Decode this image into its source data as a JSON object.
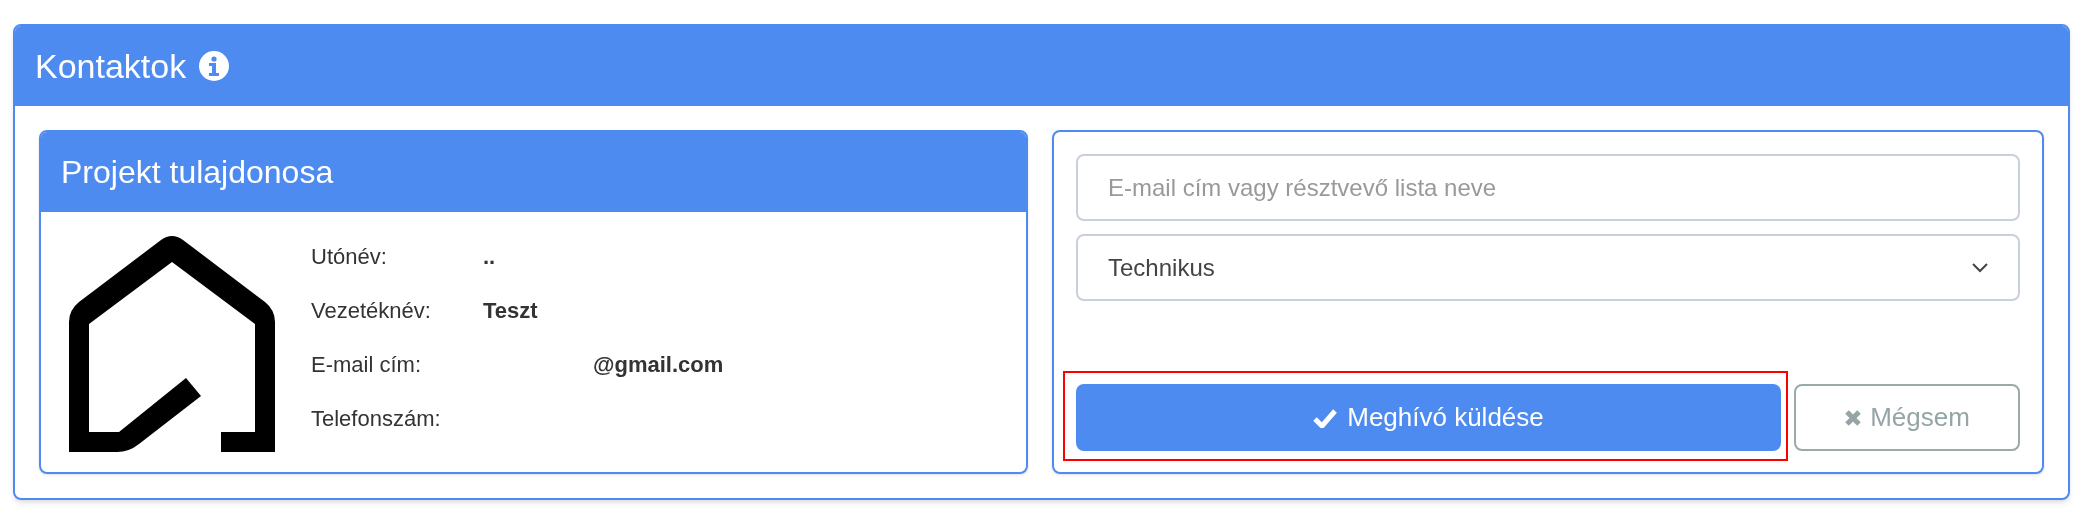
{
  "panel": {
    "title": "Kontaktok"
  },
  "owner": {
    "title": "Projekt tulajdonosa",
    "fields": [
      {
        "label": "Utónév:",
        "value": ".."
      },
      {
        "label": "Vezetéknév:",
        "value": "Teszt"
      },
      {
        "label": "E-mail cím:",
        "value": "@gmail.com",
        "kind": "redacted"
      },
      {
        "label": "Telefonszám:"
      }
    ]
  },
  "invite": {
    "email": {
      "placeholder": "E-mail cím vagy résztvevő lista neve"
    },
    "role": {
      "value": "Technikus"
    },
    "buttons": [
      {
        "kind": "primary",
        "label": "Meghívó küldése",
        "highlighted": true
      },
      {
        "kind": "secondary",
        "label": "Mégsem",
        "highlighted": false
      }
    ]
  }
}
